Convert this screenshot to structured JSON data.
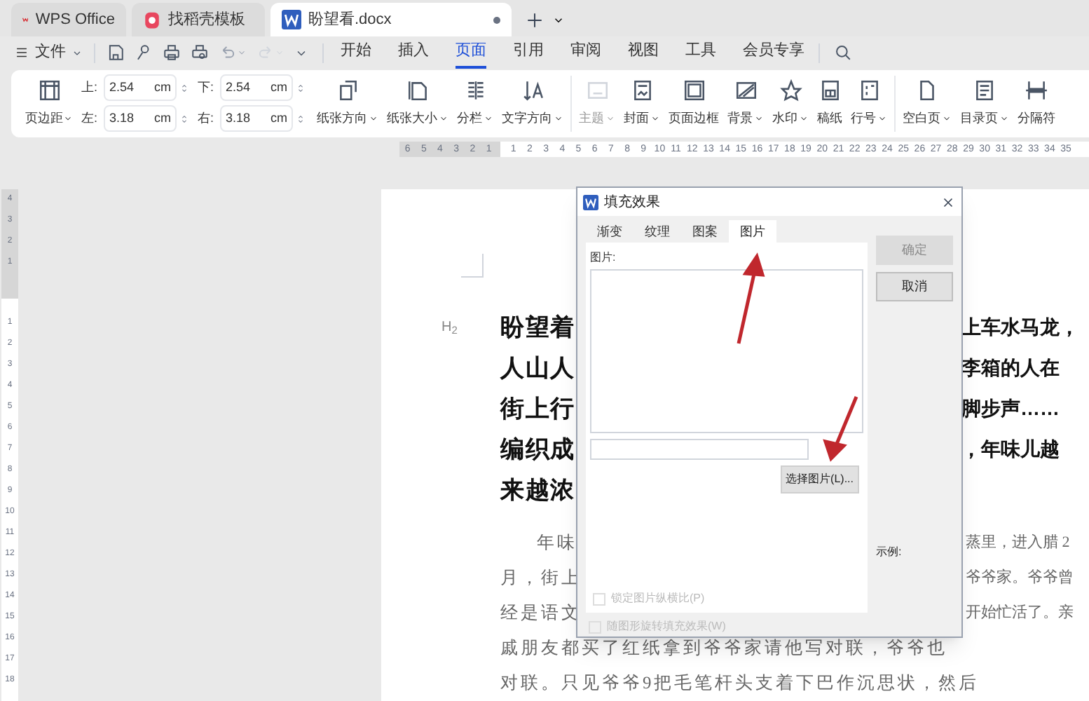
{
  "tabs": [
    {
      "kind": "home",
      "label": "WPS Office",
      "selected": false
    },
    {
      "kind": "template",
      "label": "找稻壳模板",
      "selected": false
    },
    {
      "kind": "document",
      "label": "盼望看.docx",
      "selected": true
    }
  ],
  "menu": {
    "file": "文件",
    "ribbon_tabs": [
      {
        "label": "开始",
        "selected": false
      },
      {
        "label": "插入",
        "selected": false
      },
      {
        "label": "页面",
        "selected": true
      },
      {
        "label": "引用",
        "selected": false
      },
      {
        "label": "审阅",
        "selected": false
      },
      {
        "label": "视图",
        "selected": false
      },
      {
        "label": "工具",
        "selected": false
      },
      {
        "label": "会员专享",
        "selected": false
      }
    ]
  },
  "ribbon": {
    "margins_button": "页边距",
    "margins": [
      {
        "label": "上:",
        "value": "2.54",
        "unit": "cm"
      },
      {
        "label": "下:",
        "value": "2.54",
        "unit": "cm"
      },
      {
        "label": "左:",
        "value": "3.18",
        "unit": "cm"
      },
      {
        "label": "右:",
        "value": "3.18",
        "unit": "cm"
      }
    ],
    "tool_groups": [
      {
        "tools": [
          {
            "label": "纸张方向",
            "dropdown": true,
            "disabled": false
          },
          {
            "label": "纸张大小",
            "dropdown": true,
            "disabled": false
          },
          {
            "label": "分栏",
            "dropdown": true,
            "disabled": false
          },
          {
            "label": "文字方向",
            "dropdown": true,
            "disabled": false
          }
        ]
      },
      {
        "tools": [
          {
            "label": "主题",
            "dropdown": true,
            "disabled": true
          },
          {
            "label": "封面",
            "dropdown": true,
            "disabled": false
          },
          {
            "label": "页面边框",
            "dropdown": false,
            "disabled": false
          },
          {
            "label": "背景",
            "dropdown": true,
            "disabled": false
          },
          {
            "label": "水印",
            "dropdown": true,
            "disabled": false
          },
          {
            "label": "稿纸",
            "dropdown": false,
            "disabled": false
          },
          {
            "label": "行号",
            "dropdown": true,
            "disabled": false
          }
        ]
      },
      {
        "tools": [
          {
            "label": "空白页",
            "dropdown": true,
            "disabled": false
          },
          {
            "label": "目录页",
            "dropdown": true,
            "disabled": false
          },
          {
            "label": "分隔符",
            "dropdown": false,
            "disabled": false
          }
        ]
      }
    ]
  },
  "ruler": {
    "left_ticks": [
      "6",
      "5",
      "4",
      "3",
      "2",
      "1"
    ],
    "ticks": [
      "1",
      "2",
      "3",
      "4",
      "5",
      "6",
      "7",
      "8",
      "9",
      "10",
      "11",
      "12",
      "13",
      "14",
      "15",
      "16",
      "17",
      "18",
      "19",
      "20",
      "21",
      "22",
      "23",
      "24",
      "25",
      "26",
      "27",
      "28",
      "29",
      "30",
      "31",
      "32",
      "33",
      "34",
      "35"
    ]
  },
  "vertical_ruler": {
    "top_ticks": [
      "4",
      "3",
      "2",
      "1"
    ],
    "ticks": [
      "1",
      "2",
      "3",
      "4",
      "5",
      "6",
      "7",
      "8",
      "9",
      "10",
      "11",
      "12",
      "13",
      "14",
      "15",
      "16",
      "17",
      "18"
    ]
  },
  "document": {
    "heading_marker": "H$_{2}$",
    "heading_lines": [
      {
        "left": "盼望着",
        "right": "上车水马龙，"
      },
      {
        "left": "人山人",
        "right": "李箱的人在"
      },
      {
        "left": "街上行",
        "right": "脚步声……"
      },
      {
        "left": "编织成",
        "right": "，年味儿越"
      },
      {
        "left": "来越浓"
      }
    ],
    "body_lines": [
      {
        "left": "年味",
        "right": "蒸里，进入腊 2",
        "indent": true
      },
      {
        "left": "月，街上",
        "right": "爷爷家。爷爷曾",
        "indent": false
      },
      {
        "left": "经是语文",
        "right": "开始忙活了。亲",
        "indent": false
      },
      {
        "left": "戚朋友都买了红纸拿到爷爷家请他写对联，爷爷也",
        "indent": false
      },
      {
        "left": "对联。只见爷爷9把毛笔杆头支着下巴作沉思状，然后",
        "indent": false
      }
    ]
  },
  "dialog": {
    "title": "填充效果",
    "tabs": [
      {
        "label": "渐变",
        "selected": false
      },
      {
        "label": "纹理",
        "selected": false
      },
      {
        "label": "图案",
        "selected": false
      },
      {
        "label": "图片",
        "selected": true
      }
    ],
    "picture_label": "图片:",
    "select_button": "选择图片(L)...",
    "options": [
      {
        "label": "锁定图片纵横比(P)",
        "checked": false,
        "disabled": true
      },
      {
        "label": "随图形旋转填充效果(W)",
        "checked": false,
        "disabled": true
      }
    ],
    "buttons": [
      {
        "label": "确定",
        "disabled": true
      },
      {
        "label": "取消",
        "disabled": false
      }
    ],
    "preview_label": "示例:"
  }
}
